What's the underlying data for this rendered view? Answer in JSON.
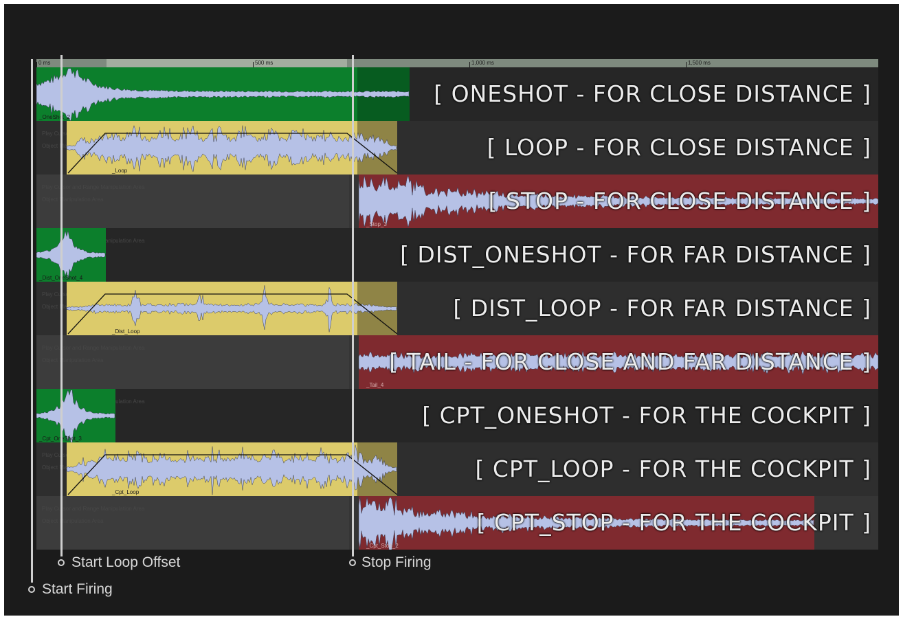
{
  "ruler": {
    "ticks": [
      "0 ms",
      "500 ms",
      "1,000 ms",
      "1,500 ms"
    ]
  },
  "track_hints": {
    "play_cursor": "Play Cursor and Range Manipulation Area",
    "object": "Object Manipulation Area"
  },
  "tracks": [
    {
      "title": "[ ONESHOT - FOR CLOSE DISTANCE ]",
      "clip_name": "_OneShot_2",
      "clip_type": "oneshot"
    },
    {
      "title": "[ LOOP - FOR CLOSE DISTANCE ]",
      "clip_name": "_Loop",
      "clip_type": "loop"
    },
    {
      "title": "[ STOP - FOR CLOSE DISTANCE ]",
      "clip_name": "_Stop_3",
      "clip_type": "stop"
    },
    {
      "title": "[ DIST_ONESHOT - FOR FAR DISTANCE ]",
      "clip_name": "_Dist_OneShot_4",
      "clip_type": "oneshot"
    },
    {
      "title": "[ DIST_LOOP - FOR FAR DISTANCE ]",
      "clip_name": "_Dist_Loop",
      "clip_type": "loop"
    },
    {
      "title": "[ TAIL - FOR CLOSE AND FAR DISTANCE ]",
      "clip_name": "_Tail_4",
      "clip_type": "stop"
    },
    {
      "title": "[ CPT_ONESHOT - FOR THE COCKPIT ]",
      "clip_name": "_Cpt_OneShot_3",
      "clip_type": "oneshot"
    },
    {
      "title": "[ CPT_LOOP - FOR THE COCKPIT ]",
      "clip_name": "_Cpt_Loop",
      "clip_type": "loop"
    },
    {
      "title": "[ CPT_STOP - FOR THE COCKPIT ]",
      "clip_name": "_Cpt_Stop_2",
      "clip_type": "stop"
    }
  ],
  "markers": {
    "start_firing": "Start Firing",
    "start_loop_offset": "Start Loop Offset",
    "stop_firing": "Stop Firing"
  },
  "colors": {
    "oneshot": "#0c7f2c",
    "loop": "#dccb6b",
    "stop": "#7f2a2f",
    "waveform": "#b6c1e6"
  }
}
